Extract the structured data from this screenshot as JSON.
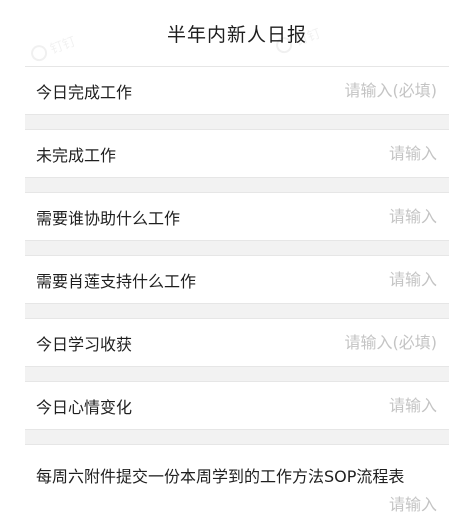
{
  "header": {
    "title": "半年内新人日报"
  },
  "form": {
    "fields": [
      {
        "label": "今日完成工作",
        "placeholder": "请输入(必填)"
      },
      {
        "label": "未完成工作",
        "placeholder": "请输入"
      },
      {
        "label": "需要谁协助什么工作",
        "placeholder": "请输入"
      },
      {
        "label": "需要肖莲支持什么工作",
        "placeholder": "请输入"
      },
      {
        "label": "今日学习收获",
        "placeholder": "请输入(必填)"
      },
      {
        "label": "今日心情变化",
        "placeholder": "请输入"
      },
      {
        "label": "每周六附件提交一份本周学到的工作方法SOP流程表",
        "placeholder": "请输入"
      }
    ]
  },
  "watermark": {
    "brand": "钉钉",
    "brand_en": "DingTalk"
  }
}
